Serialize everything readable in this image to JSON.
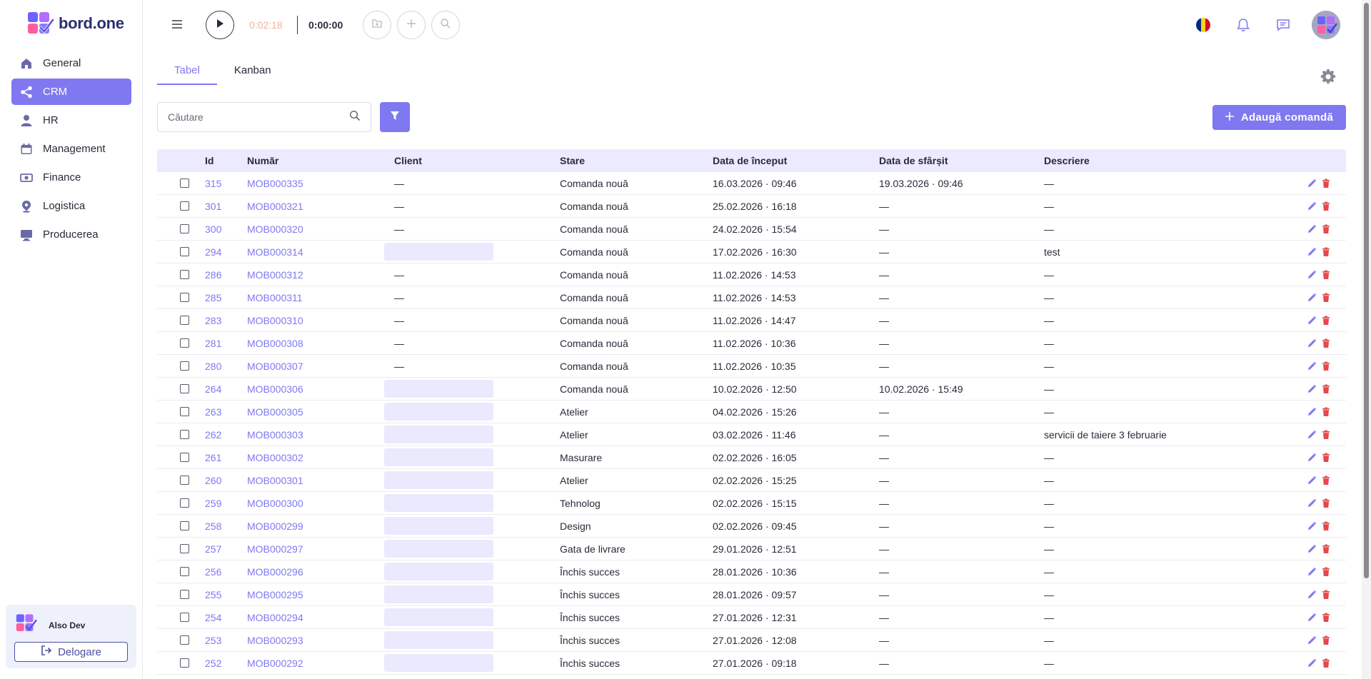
{
  "app": {
    "logo_text": "bord.one"
  },
  "sidebar": {
    "items": [
      {
        "label": "General",
        "icon": "home-icon",
        "active": false
      },
      {
        "label": "CRM",
        "icon": "share-icon",
        "active": true
      },
      {
        "label": "HR",
        "icon": "person-icon",
        "active": false
      },
      {
        "label": "Management",
        "icon": "calendar-icon",
        "active": false
      },
      {
        "label": "Finance",
        "icon": "money-icon",
        "active": false
      },
      {
        "label": "Logistica",
        "icon": "location-pin-icon",
        "active": false
      },
      {
        "label": "Producerea",
        "icon": "monitor-icon",
        "active": false
      }
    ],
    "user": {
      "name": "Also Dev",
      "logout_label": "Delogare"
    }
  },
  "topbar": {
    "timer_elapsed": "0:02:18",
    "timer_current": "0:00:00"
  },
  "tabs": [
    {
      "label": "Tabel",
      "active": true
    },
    {
      "label": "Kanban",
      "active": false
    }
  ],
  "search": {
    "placeholder": "Căutare",
    "value": ""
  },
  "add_button_label": "Adaugă comandă",
  "colors": {
    "accent": "#7f78f0",
    "header_bg": "#eceaff",
    "delete": "#e5484d"
  },
  "table": {
    "columns": [
      "Id",
      "Număr",
      "Client",
      "Stare",
      "Data de început",
      "Data de sfârșit",
      "Descriere"
    ],
    "rows": [
      {
        "id": "315",
        "num": "MOB000335",
        "client": "—",
        "client_hidden": false,
        "stare": "Comanda nouă",
        "start": "16.03.2026 · 09:46",
        "end": "19.03.2026 · 09:46",
        "desc": "—"
      },
      {
        "id": "301",
        "num": "MOB000321",
        "client": "—",
        "client_hidden": false,
        "stare": "Comanda nouă",
        "start": "25.02.2026 · 16:18",
        "end": "—",
        "desc": "—"
      },
      {
        "id": "300",
        "num": "MOB000320",
        "client": "—",
        "client_hidden": false,
        "stare": "Comanda nouă",
        "start": "24.02.2026 · 15:54",
        "end": "—",
        "desc": "—"
      },
      {
        "id": "294",
        "num": "MOB000314",
        "client": "",
        "client_hidden": true,
        "stare": "Comanda nouă",
        "start": "17.02.2026 · 16:30",
        "end": "—",
        "desc": "test"
      },
      {
        "id": "286",
        "num": "MOB000312",
        "client": "—",
        "client_hidden": false,
        "stare": "Comanda nouă",
        "start": "11.02.2026 · 14:53",
        "end": "—",
        "desc": "—"
      },
      {
        "id": "285",
        "num": "MOB000311",
        "client": "—",
        "client_hidden": false,
        "stare": "Comanda nouă",
        "start": "11.02.2026 · 14:53",
        "end": "—",
        "desc": "—"
      },
      {
        "id": "283",
        "num": "MOB000310",
        "client": "—",
        "client_hidden": false,
        "stare": "Comanda nouă",
        "start": "11.02.2026 · 14:47",
        "end": "—",
        "desc": "—"
      },
      {
        "id": "281",
        "num": "MOB000308",
        "client": "—",
        "client_hidden": false,
        "stare": "Comanda nouă",
        "start": "11.02.2026 · 10:36",
        "end": "—",
        "desc": "—"
      },
      {
        "id": "280",
        "num": "MOB000307",
        "client": "—",
        "client_hidden": false,
        "stare": "Comanda nouă",
        "start": "11.02.2026 · 10:35",
        "end": "—",
        "desc": "—"
      },
      {
        "id": "264",
        "num": "MOB000306",
        "client": "",
        "client_hidden": true,
        "stare": "Comanda nouă",
        "start": "10.02.2026 · 12:50",
        "end": "10.02.2026 · 15:49",
        "desc": "—"
      },
      {
        "id": "263",
        "num": "MOB000305",
        "client": "",
        "client_hidden": true,
        "stare": "Atelier",
        "start": "04.02.2026 · 15:26",
        "end": "—",
        "desc": "—"
      },
      {
        "id": "262",
        "num": "MOB000303",
        "client": "",
        "client_hidden": true,
        "stare": "Atelier",
        "start": "03.02.2026 · 11:46",
        "end": "—",
        "desc": "servicii de taiere 3 februarie"
      },
      {
        "id": "261",
        "num": "MOB000302",
        "client": "",
        "client_hidden": true,
        "stare": "Masurare",
        "start": "02.02.2026 · 16:05",
        "end": "—",
        "desc": "—"
      },
      {
        "id": "260",
        "num": "MOB000301",
        "client": "",
        "client_hidden": true,
        "stare": "Atelier",
        "start": "02.02.2026 · 15:25",
        "end": "—",
        "desc": "—"
      },
      {
        "id": "259",
        "num": "MOB000300",
        "client": "",
        "client_hidden": true,
        "stare": "Tehnolog",
        "start": "02.02.2026 · 15:15",
        "end": "—",
        "desc": "—"
      },
      {
        "id": "258",
        "num": "MOB000299",
        "client": "",
        "client_hidden": true,
        "stare": "Design",
        "start": "02.02.2026 · 09:45",
        "end": "—",
        "desc": "—"
      },
      {
        "id": "257",
        "num": "MOB000297",
        "client": "",
        "client_hidden": true,
        "stare": "Gata de livrare",
        "start": "29.01.2026 · 12:51",
        "end": "—",
        "desc": "—"
      },
      {
        "id": "256",
        "num": "MOB000296",
        "client": "",
        "client_hidden": true,
        "stare": "Închis succes",
        "start": "28.01.2026 · 10:36",
        "end": "—",
        "desc": "—"
      },
      {
        "id": "255",
        "num": "MOB000295",
        "client": "",
        "client_hidden": true,
        "stare": "Închis succes",
        "start": "28.01.2026 · 09:57",
        "end": "—",
        "desc": "—"
      },
      {
        "id": "254",
        "num": "MOB000294",
        "client": "",
        "client_hidden": true,
        "stare": "Închis succes",
        "start": "27.01.2026 · 12:31",
        "end": "—",
        "desc": "—"
      },
      {
        "id": "253",
        "num": "MOB000293",
        "client": "",
        "client_hidden": true,
        "stare": "Închis succes",
        "start": "27.01.2026 · 12:08",
        "end": "—",
        "desc": "—"
      },
      {
        "id": "252",
        "num": "MOB000292",
        "client": "",
        "client_hidden": true,
        "stare": "Închis succes",
        "start": "27.01.2026 · 09:18",
        "end": "—",
        "desc": "—"
      }
    ]
  }
}
